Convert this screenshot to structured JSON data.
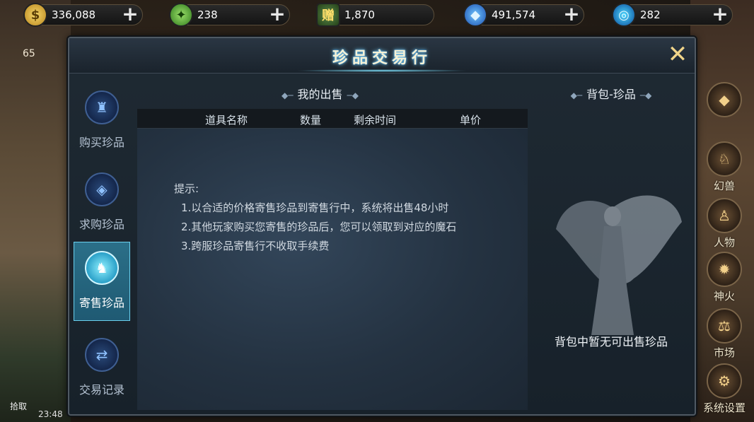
{
  "resources": [
    {
      "icon": "gold-coin-icon",
      "glyph": "$",
      "value": "336,088"
    },
    {
      "icon": "jade-icon",
      "glyph": "✦",
      "value": "238"
    },
    {
      "icon": "card-icon",
      "glyph": "赠",
      "value": "1,870"
    },
    {
      "icon": "crystal-icon",
      "glyph": "◆",
      "value": "491,574"
    },
    {
      "icon": "orb-icon",
      "glyph": "◎",
      "value": "282"
    }
  ],
  "plus_glyph": "+",
  "dialog": {
    "title": "珍品交易行",
    "close_glyph": "✕"
  },
  "tabs": [
    {
      "label": "购买珍品",
      "glyph": "♜"
    },
    {
      "label": "求购珍品",
      "glyph": "◈"
    },
    {
      "label": "寄售珍品",
      "glyph": "♞",
      "active": true
    },
    {
      "label": "交易记录",
      "glyph": "⇄"
    }
  ],
  "sale": {
    "heading": "我的出售",
    "columns": [
      "道具名称",
      "数量",
      "剩余时间",
      "单价"
    ],
    "tips_title": "提示:",
    "tips": [
      "1.以合适的价格寄售珍品到寄售行中，系统将出售48小时",
      "2.其他玩家购买您寄售的珍品后，您可以领取到对应的魔石",
      "3.跨服珍品寄售行不收取手续费"
    ]
  },
  "bag": {
    "heading": "背包-珍品",
    "empty_text": "背包中暂无可出售珍品"
  },
  "side_menu": [
    {
      "label": "",
      "glyph": "◆"
    },
    {
      "label": "幻兽",
      "glyph": "♘"
    },
    {
      "label": "人物",
      "glyph": "♙"
    },
    {
      "label": "神火",
      "glyph": "✹"
    },
    {
      "label": "市场",
      "glyph": "⚖"
    },
    {
      "label": "系统设置",
      "glyph": "⚙"
    }
  ],
  "hud": {
    "level": "65",
    "pickup_label": "拾取",
    "time": "23:48"
  },
  "colors": {
    "accent": "#6ad0ee",
    "title_glow": "#7fd7ff",
    "dialog_bg": "#17212a"
  }
}
